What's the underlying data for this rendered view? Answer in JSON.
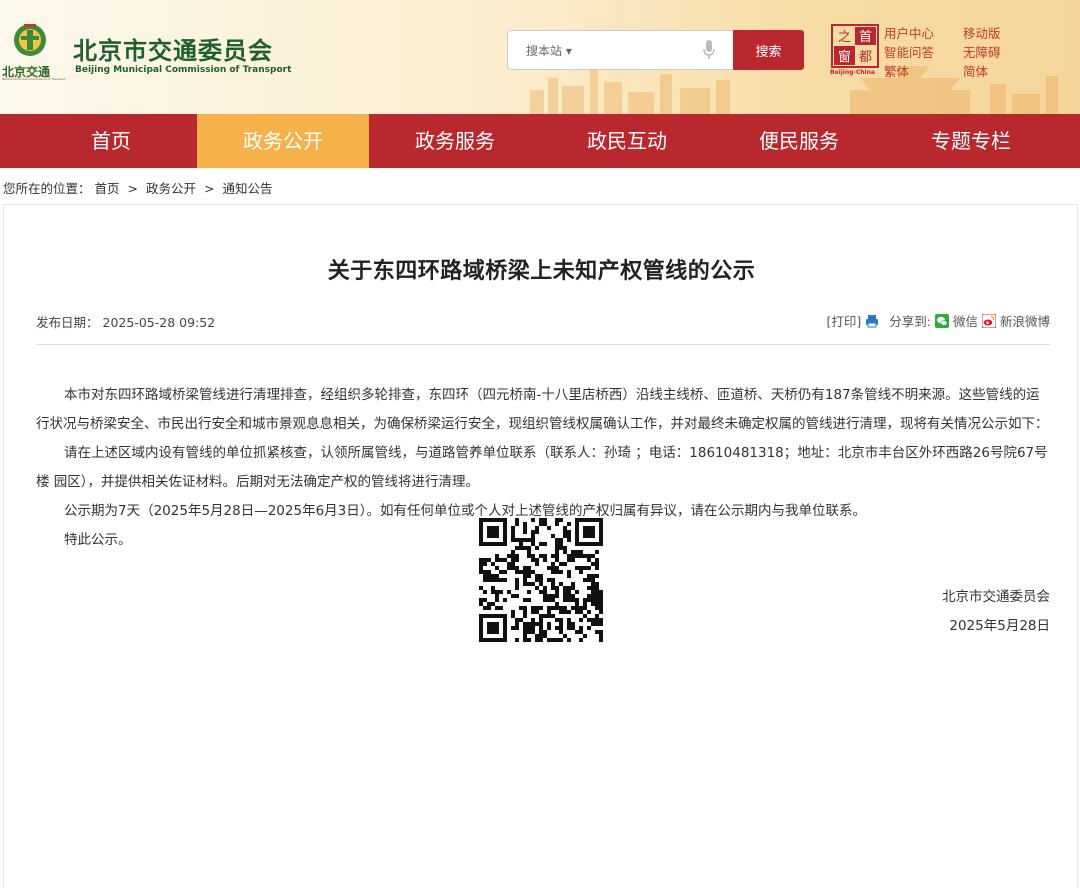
{
  "header": {
    "logo_small": "北京交通",
    "logo_small_sub": "Beijing Municipal Commission of Transport",
    "site_title": "北京市交通委员会",
    "site_title_en": "Beijing Municipal Commission of Transport",
    "search_placeholder": "搜本站 ▾",
    "search_button": "搜索",
    "seal_text": [
      "首",
      "都",
      "之",
      "窗"
    ],
    "seal_caption": "Beijing-China",
    "links": {
      "user_center": "用户中心",
      "smart_qa": "智能问答",
      "traditional": "繁体",
      "mobile": "移动版",
      "accessible": "无障碍",
      "simplified": "简体"
    }
  },
  "nav": {
    "items": [
      "首页",
      "政务公开",
      "政务服务",
      "政民互动",
      "便民服务",
      "专题专栏"
    ],
    "active_index": 1
  },
  "breadcrumb": {
    "prefix": "您所在的位置：",
    "items": [
      "首页",
      "政务公开",
      "通知公告"
    ],
    "separator": ">"
  },
  "article": {
    "title": "关于东四环路域桥梁上未知产权管线的公示",
    "date_label": "发布日期：",
    "date": "2025-05-28 09:52",
    "print_label": "[打印]",
    "share_label": "分享到:",
    "wechat_label": "微信",
    "weibo_label": "新浪微博",
    "paragraphs": [
      "本市对东四环路域桥梁管线进行清理排查，经组织多轮排查，东四环（四元桥南-十八里店桥西）沿线主线桥、匝道桥、天桥仍有187条管线不明来源。这些管线的运行状况与桥梁安全、市民出行安全和城市景观息息相关，为确保桥梁运行安全，现组织管线权属确认工作，并对最终未确定权属的管线进行清理，现将有关情况公示如下：",
      "请在上述区域内设有管线的单位抓紧核查，认领所属管线，与道路管养单位联系（联系人：孙琦 ；电话：18610481318；地址：北京市丰台区外环西路26号院67号楼 园区），并提供相关佐证材料。后期对无法确定产权的管线将进行清理。",
      "公示期为7天（2025年5月28日—2025年6月3日）。如有任何单位或个人对上述管线的产权归属有异议，请在公示期内与我单位联系。",
      "特此公示。"
    ],
    "signature_org": "北京市交通委员会",
    "signature_date": "2025年5月28日"
  },
  "colors": {
    "brand_red": "#b9282e",
    "nav_active": "#f6b24a",
    "logo_green": "#1f5f2f"
  }
}
